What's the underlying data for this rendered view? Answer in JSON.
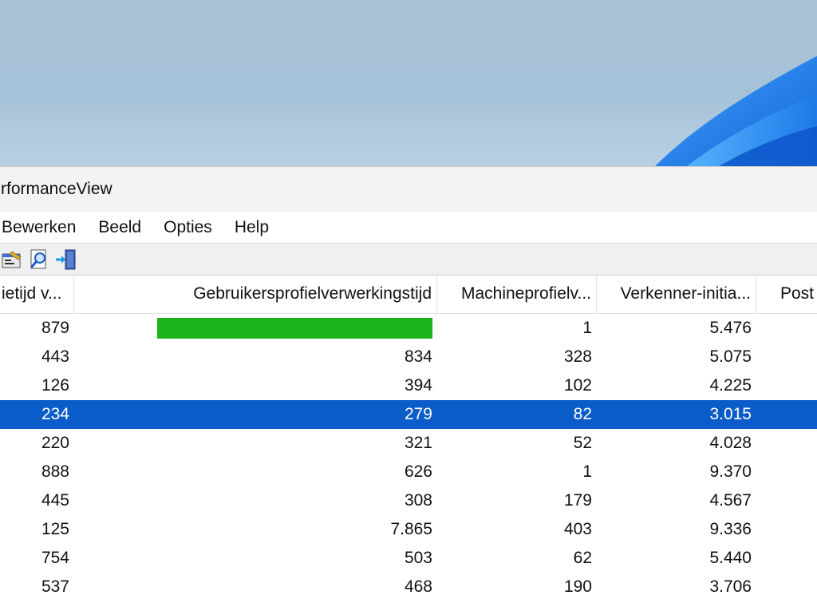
{
  "window": {
    "title": "rformanceView"
  },
  "menu": [
    "Bewerken",
    "Beeld",
    "Opties",
    "Help"
  ],
  "toolbar": {
    "icons": [
      "properties-icon",
      "search-icon",
      "exit-icon"
    ]
  },
  "table": {
    "columns": [
      "ietijd v...",
      "Gebruikersprofielverwerkingstijd",
      "Machineprofielv...",
      "Verkenner-initia...",
      "Post"
    ],
    "rows": [
      {
        "c0": "879",
        "c1": "",
        "c1_bar": 1.0,
        "c2": "1",
        "c3": "5.476"
      },
      {
        "c0": "443",
        "c1": "834",
        "c2": "328",
        "c3": "5.075"
      },
      {
        "c0": "126",
        "c1": "394",
        "c2": "102",
        "c3": "4.225"
      },
      {
        "c0": "234",
        "c1": "279",
        "c2": "82",
        "c3": "3.015",
        "selected": true
      },
      {
        "c0": "220",
        "c1": "321",
        "c2": "52",
        "c3": "4.028"
      },
      {
        "c0": "888",
        "c1": "626",
        "c2": "1",
        "c3": "9.370"
      },
      {
        "c0": "445",
        "c1": "308",
        "c2": "179",
        "c3": "4.567"
      },
      {
        "c0": "125",
        "c1": "7.865",
        "c2": "403",
        "c3": "9.336"
      },
      {
        "c0": "754",
        "c1": "503",
        "c2": "62",
        "c3": "5.440"
      },
      {
        "c0": "537",
        "c1": "468",
        "c2": "190",
        "c3": "3.706"
      }
    ],
    "selected_color": "#0a5cc8",
    "bar_color": "#1db31d"
  }
}
